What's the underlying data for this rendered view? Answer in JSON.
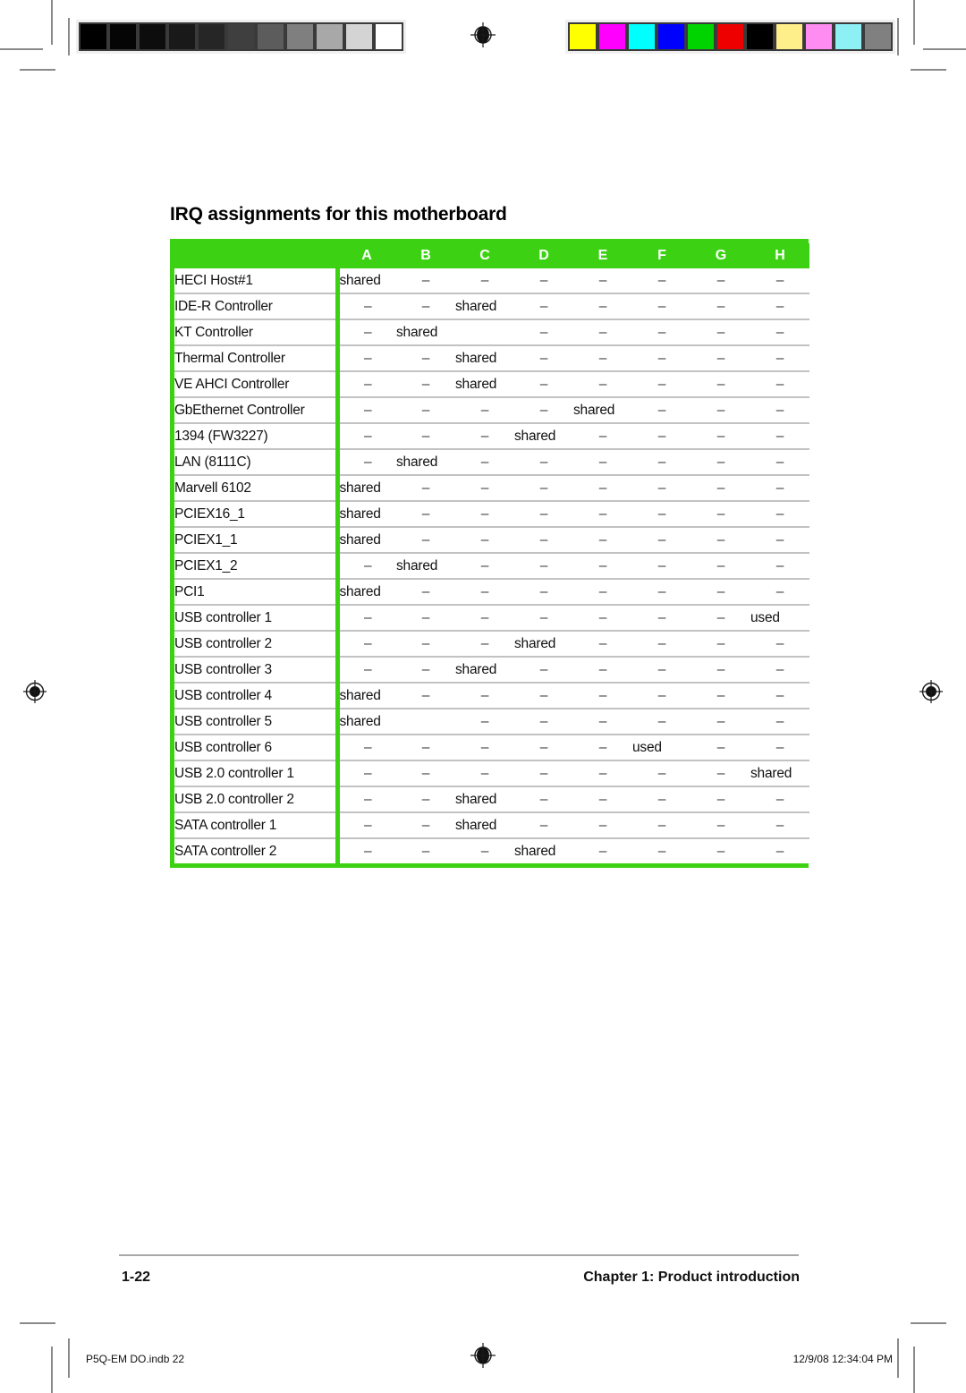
{
  "page": {
    "heading": "IRQ assignments for this motherboard",
    "folio": "1-22",
    "running_head": "Chapter 1: Product introduction",
    "accent_green": "#3cd213",
    "rule_gray": "#c2c2c2"
  },
  "slug": {
    "left": "P5Q-EM DO.indb   22",
    "right": "12/9/08   12:34:04 PM"
  },
  "calibration": {
    "gray_wedge": [
      "#000000",
      "#050505",
      "#0d0d0d",
      "#191919",
      "#262626",
      "#3f3f3f",
      "#5c5c5c",
      "#7f7f7f",
      "#a8a8a8",
      "#d4d4d4",
      "#ffffff"
    ],
    "color_wedge": [
      "#ffff00",
      "#ff00ff",
      "#00ffff",
      "#0000ff",
      "#00d400",
      "#ee0000",
      "#000000",
      "#ffef8a",
      "#ff8cf0",
      "#8cf0f5",
      "#808080"
    ]
  },
  "table": {
    "columns": [
      "",
      "A",
      "B",
      "C",
      "D",
      "E",
      "F",
      "G",
      "H"
    ],
    "dash": "–",
    "shared": "shared",
    "used": "used",
    "rows": [
      {
        "label": "HECI Host#1",
        "cells": [
          "shared",
          "–",
          "–",
          "–",
          "–",
          "–",
          "–",
          "–"
        ]
      },
      {
        "label": "IDE-R Controller",
        "cells": [
          "–",
          "–",
          "shared",
          "–",
          "–",
          "–",
          "–",
          "–"
        ]
      },
      {
        "label": "KT Controller",
        "cells": [
          "–",
          "shared",
          "",
          "–",
          "–",
          "–",
          "–",
          "–"
        ]
      },
      {
        "label": "Thermal Controller",
        "cells": [
          "–",
          "–",
          "shared",
          "–",
          "–",
          "–",
          "–",
          "–"
        ]
      },
      {
        "label": "VE AHCI Controller",
        "cells": [
          "–",
          "–",
          "shared",
          "–",
          "–",
          "–",
          "–",
          "–"
        ]
      },
      {
        "label": "GbEthernet Controller",
        "cells": [
          "–",
          "–",
          "–",
          "–",
          "shared",
          "–",
          "–",
          "–"
        ]
      },
      {
        "label": "1394 (FW3227)",
        "cells": [
          "–",
          "–",
          "–",
          "shared",
          "–",
          "–",
          "–",
          "–"
        ]
      },
      {
        "label": "LAN (8111C)",
        "cells": [
          "–",
          "shared",
          "–",
          "–",
          "–",
          "–",
          "–",
          "–"
        ]
      },
      {
        "label": "Marvell 6102",
        "cells": [
          "shared",
          "–",
          "–",
          "–",
          "–",
          "–",
          "–",
          "–"
        ]
      },
      {
        "label": "PCIEX16_1",
        "cells": [
          "shared",
          "–",
          "–",
          "–",
          "–",
          "–",
          "–",
          "–"
        ]
      },
      {
        "label": "PCIEX1_1",
        "cells": [
          "shared",
          "–",
          "–",
          "–",
          "–",
          "–",
          "–",
          "–"
        ]
      },
      {
        "label": "PCIEX1_2",
        "cells": [
          "–",
          "shared",
          "–",
          "–",
          "–",
          "–",
          "–",
          "–"
        ]
      },
      {
        "label": "PCI1",
        "cells": [
          "shared",
          "–",
          "–",
          "–",
          "–",
          "–",
          "–",
          "–"
        ]
      },
      {
        "label": "USB controller 1",
        "cells": [
          "–",
          "–",
          "–",
          "–",
          "–",
          "–",
          "–",
          "used"
        ]
      },
      {
        "label": "USB controller 2",
        "cells": [
          "–",
          "–",
          "–",
          "shared",
          "–",
          "–",
          "–",
          "–"
        ]
      },
      {
        "label": "USB controller 3",
        "cells": [
          "–",
          "–",
          "shared",
          "–",
          "–",
          "–",
          "–",
          "–"
        ]
      },
      {
        "label": "USB controller 4",
        "cells": [
          "shared",
          "–",
          "–",
          "–",
          "–",
          "–",
          "–",
          "–"
        ]
      },
      {
        "label": "USB controller 5",
        "cells": [
          "shared",
          "",
          "–",
          "–",
          "–",
          "–",
          "–",
          "–"
        ]
      },
      {
        "label": "USB controller 6",
        "cells": [
          "–",
          "–",
          "–",
          "–",
          "–",
          "used",
          "–",
          "–"
        ]
      },
      {
        "label": "USB 2.0 controller 1",
        "cells": [
          "–",
          "–",
          "–",
          "–",
          "–",
          "–",
          "–",
          "shared"
        ]
      },
      {
        "label": "USB 2.0 controller 2",
        "cells": [
          "–",
          "–",
          "shared",
          "–",
          "–",
          "–",
          "–",
          "–"
        ]
      },
      {
        "label": "SATA controller 1",
        "cells": [
          "–",
          "–",
          "shared",
          "–",
          "–",
          "–",
          "–",
          "–"
        ]
      },
      {
        "label": "SATA controller 2",
        "cells": [
          "–",
          "–",
          "–",
          "shared",
          "–",
          "–",
          "–",
          "–"
        ]
      }
    ]
  }
}
